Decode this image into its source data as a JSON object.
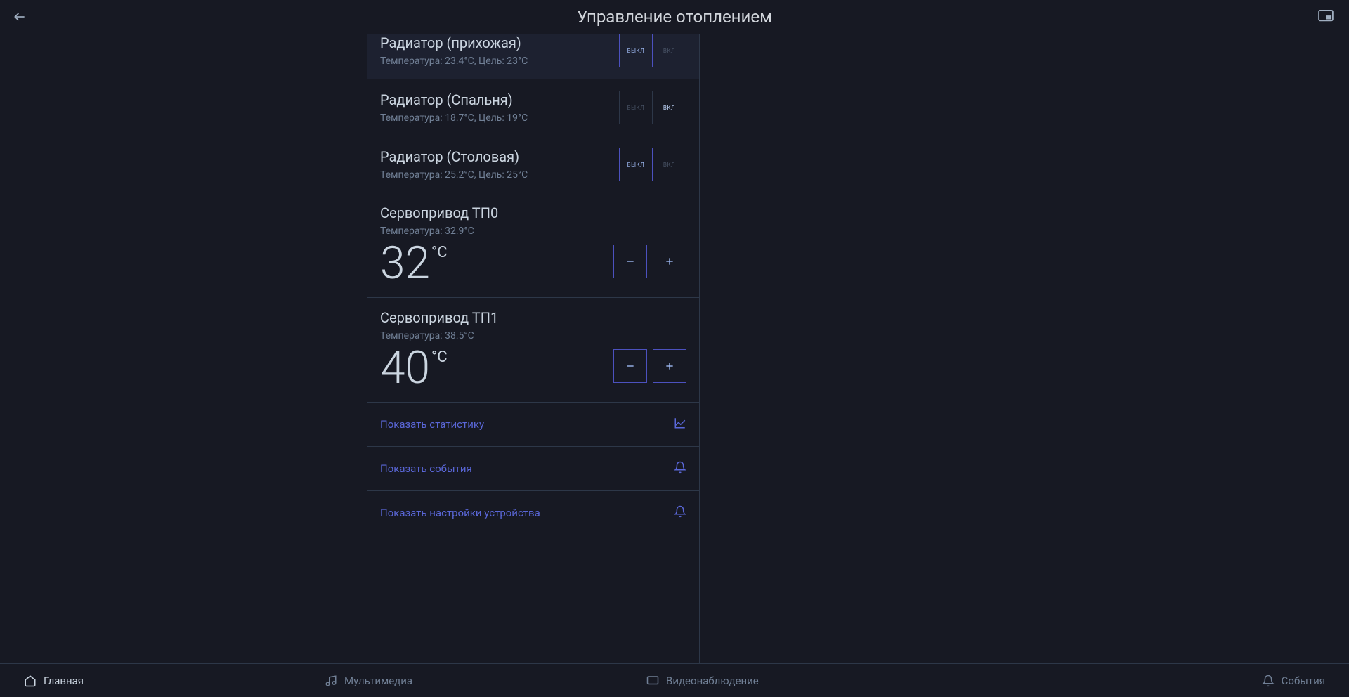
{
  "header": {
    "title": "Управление отоплением"
  },
  "devices": {
    "radiator_hall": {
      "title": "Радиатор (прихожая)",
      "sub": "Температура: 23.4°C, Цель: 23°C",
      "off": "ВЫКЛ",
      "on": "ВКЛ",
      "state": "off"
    },
    "radiator_bedroom": {
      "title": "Радиатор (Спальня)",
      "sub": "Температура: 18.7°C, Цель: 19°C",
      "off": "ВЫКЛ",
      "on": "ВКЛ",
      "state": "on"
    },
    "radiator_dining": {
      "title": "Радиатор (Столовая)",
      "sub": "Температура: 25.2°C, Цель: 25°C",
      "off": "ВЫКЛ",
      "on": "ВКЛ",
      "state": "off"
    },
    "servo0": {
      "title": "Сервопривод ТП0",
      "sub": "Температура: 32.9°C",
      "value": "32",
      "unit": "°C"
    },
    "servo1": {
      "title": "Сервопривод ТП1",
      "sub": "Температура: 38.5°C",
      "value": "40",
      "unit": "°C"
    }
  },
  "links": {
    "stats": "Показать статистику",
    "events": "Показать события",
    "settings": "Показать настройки устройства"
  },
  "nav": {
    "home": "Главная",
    "media": "Мультимедиа",
    "cctv": "Видеонаблюдение",
    "events": "События"
  }
}
